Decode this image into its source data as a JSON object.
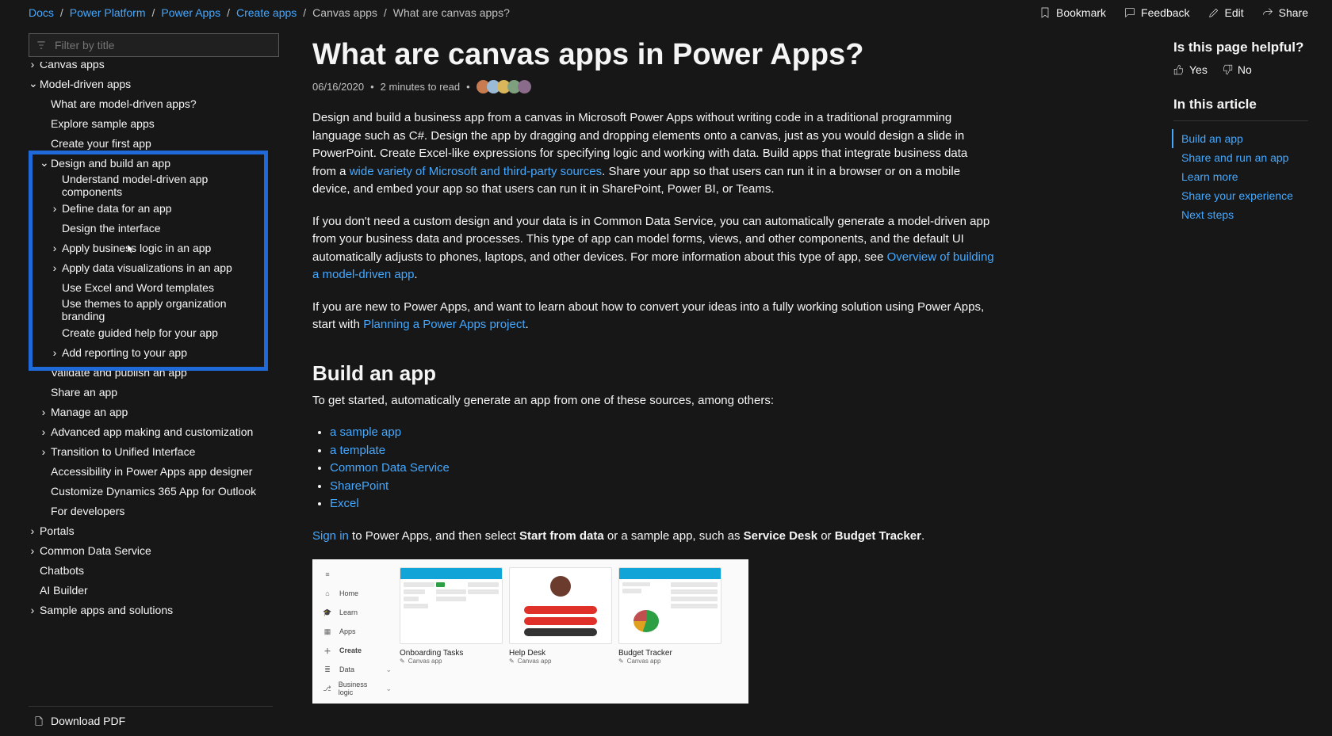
{
  "breadcrumbs": [
    {
      "label": "Docs",
      "link": true
    },
    {
      "label": "Power Platform",
      "link": true
    },
    {
      "label": "Power Apps",
      "link": true
    },
    {
      "label": "Create apps",
      "link": true
    },
    {
      "label": "Canvas apps",
      "link": false
    },
    {
      "label": "What are canvas apps?",
      "link": false
    }
  ],
  "actions": {
    "bookmark": "Bookmark",
    "feedback": "Feedback",
    "edit": "Edit",
    "share": "Share"
  },
  "filter_placeholder": "Filter by title",
  "toc": [
    {
      "lvl": 0,
      "arrow": "›",
      "label": "Canvas apps"
    },
    {
      "lvl": 0,
      "arrow": "⌄",
      "label": "Model-driven apps"
    },
    {
      "lvl": 1,
      "arrow": "",
      "label": "What are model-driven apps?"
    },
    {
      "lvl": 1,
      "arrow": "",
      "label": "Explore sample apps"
    },
    {
      "lvl": 1,
      "arrow": "",
      "label": "Create your first app"
    },
    {
      "lvl": 1,
      "arrow": "⌄",
      "label": "Design and build an app"
    },
    {
      "lvl": 2,
      "arrow": "",
      "label": "Understand model-driven app components"
    },
    {
      "lvl": 2,
      "arrow": "›",
      "label": "Define data for an app"
    },
    {
      "lvl": 2,
      "arrow": "",
      "label": "Design the interface"
    },
    {
      "lvl": 2,
      "arrow": "›",
      "label": "Apply business logic in an app"
    },
    {
      "lvl": 2,
      "arrow": "›",
      "label": "Apply data visualizations in an app"
    },
    {
      "lvl": 2,
      "arrow": "",
      "label": "Use Excel and Word templates"
    },
    {
      "lvl": 2,
      "arrow": "",
      "label": "Use themes to apply organization branding"
    },
    {
      "lvl": 2,
      "arrow": "",
      "label": "Create guided help for your app"
    },
    {
      "lvl": 2,
      "arrow": "›",
      "label": "Add reporting to your app"
    },
    {
      "lvl": 1,
      "arrow": "",
      "label": "Validate and publish an app"
    },
    {
      "lvl": 1,
      "arrow": "",
      "label": "Share an app"
    },
    {
      "lvl": 1,
      "arrow": "›",
      "label": "Manage an app"
    },
    {
      "lvl": 1,
      "arrow": "›",
      "label": "Advanced app making and customization"
    },
    {
      "lvl": 1,
      "arrow": "›",
      "label": "Transition to Unified Interface"
    },
    {
      "lvl": 1,
      "arrow": "",
      "label": "Accessibility in Power Apps app designer"
    },
    {
      "lvl": 1,
      "arrow": "",
      "label": "Customize Dynamics 365 App for Outlook"
    },
    {
      "lvl": 1,
      "arrow": "",
      "label": "For developers"
    },
    {
      "lvl": 0,
      "arrow": "›",
      "label": "Portals"
    },
    {
      "lvl": 0,
      "arrow": "›",
      "label": "Common Data Service"
    },
    {
      "lvl": 0,
      "arrow": "",
      "label": "Chatbots"
    },
    {
      "lvl": 0,
      "arrow": "",
      "label": "AI Builder"
    },
    {
      "lvl": 0,
      "arrow": "›",
      "label": "Sample apps and solutions"
    }
  ],
  "download_pdf": "Download PDF",
  "article": {
    "title": "What are canvas apps in Power Apps?",
    "date": "06/16/2020",
    "readtime": "2 minutes to read",
    "p1_a": "Design and build a business app from a canvas in Microsoft Power Apps without writing code in a traditional programming language such as C#. Design the app by dragging and dropping elements onto a canvas, just as you would design a slide in PowerPoint. Create Excel-like expressions for specifying logic and working with data. Build apps that integrate business data from a ",
    "p1_link": "wide variety of Microsoft and third-party sources",
    "p1_b": ". Share your app so that users can run it in a browser or on a mobile device, and embed your app so that users can run it in SharePoint, Power BI, or Teams.",
    "p2_a": "If you don't need a custom design and your data is in Common Data Service, you can automatically generate a model-driven app from your business data and processes. This type of app can model forms, views, and other components, and the default UI automatically adjusts to phones, laptops, and other devices. For more information about this type of app, see ",
    "p2_link": "Overview of building a model-driven app",
    "p2_b": ".",
    "p3_a": "If you are new to Power Apps, and want to learn about how to convert your ideas into a fully working solution using Power Apps, start with ",
    "p3_link": "Planning a Power Apps project",
    "p3_b": ".",
    "h2_build": "Build an app",
    "p4": "To get started, automatically generate an app from one of these sources, among others:",
    "list": [
      "a sample app",
      "a template",
      "Common Data Service",
      "SharePoint",
      "Excel"
    ],
    "p5_signin": "Sign in",
    "p5_a": " to Power Apps, and then select ",
    "p5_b1": "Start from data",
    "p5_c": " or a sample app, such as ",
    "p5_b2": "Service Desk",
    "p5_d": " or ",
    "p5_b3": "Budget Tracker",
    "p5_e": "."
  },
  "shot": {
    "nav": [
      "Home",
      "Learn",
      "Apps",
      "Create",
      "Data",
      "Business logic"
    ],
    "tiles": [
      {
        "title": "Onboarding Tasks",
        "sub": "Canvas app",
        "head": "#11a4d6"
      },
      {
        "title": "Help Desk",
        "sub": "Canvas app",
        "head": "#000"
      },
      {
        "title": "Budget Tracker",
        "sub": "Canvas app",
        "head": "#11a4d6"
      }
    ]
  },
  "rail": {
    "helpful_q": "Is this page helpful?",
    "yes": "Yes",
    "no": "No",
    "in_article": "In this article",
    "links": [
      {
        "label": "Build an app",
        "active": true
      },
      {
        "label": "Share and run an app"
      },
      {
        "label": "Learn more"
      },
      {
        "label": "Share your experience"
      },
      {
        "label": "Next steps"
      }
    ]
  },
  "avatar_colors": [
    "#c77b4e",
    "#9bbad6",
    "#d9b65a",
    "#7fa07f",
    "#8b6b8b"
  ]
}
